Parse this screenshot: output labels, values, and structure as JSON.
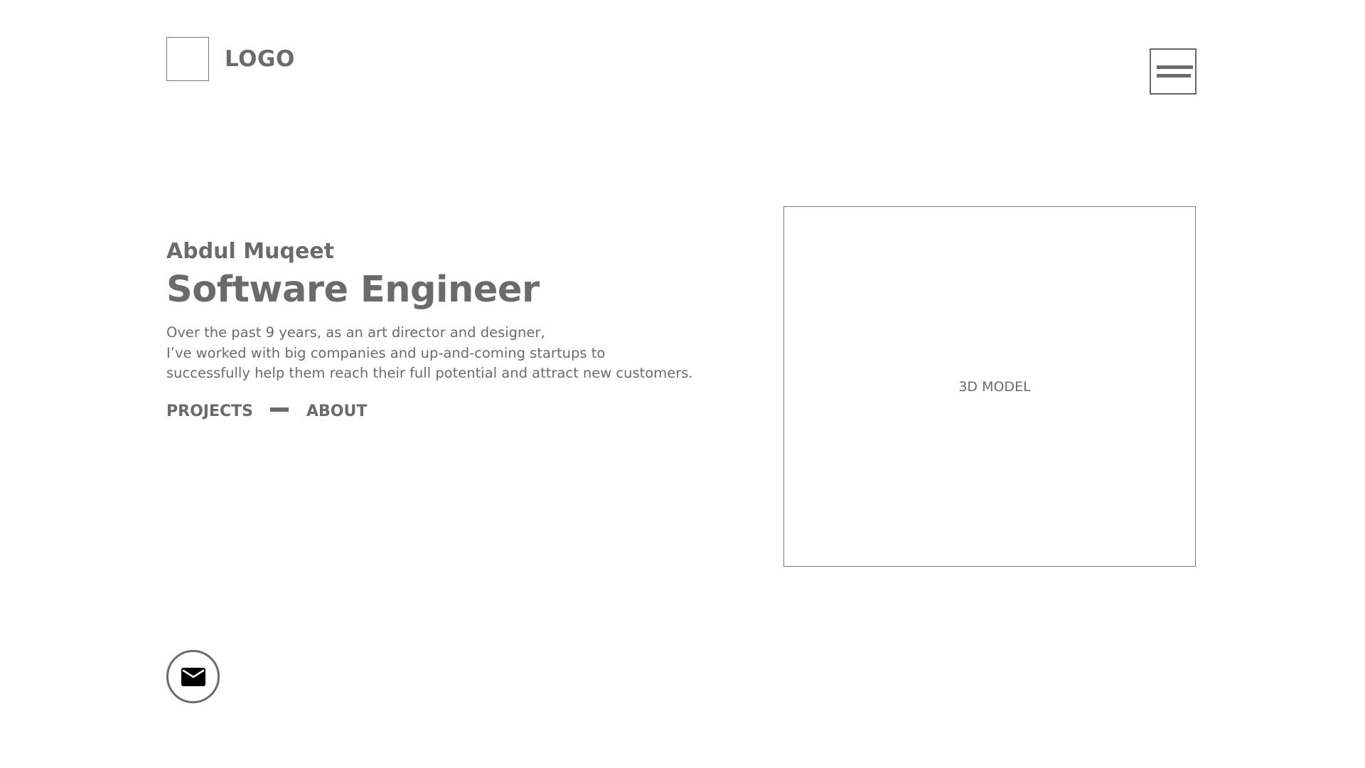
{
  "header": {
    "logo_text": "LOGO",
    "menu_icon": "hamburger-menu-icon"
  },
  "hero": {
    "name": "Abdul Muqeet",
    "title": "Software Engineer",
    "description_lines": [
      "Over the past 9 years, as an art director and designer,",
      "I’ve worked with big companies and up-and-coming startups to",
      "successfully help them reach their full potential and attract new customers."
    ],
    "nav": {
      "projects_label": "PROJECTS",
      "about_label": "ABOUT"
    }
  },
  "model_panel": {
    "label": "3D MODEL"
  },
  "contact": {
    "icon": "mail-icon"
  },
  "colors": {
    "text": "#6b6b6b",
    "border": "#777777",
    "background": "#ffffff"
  }
}
